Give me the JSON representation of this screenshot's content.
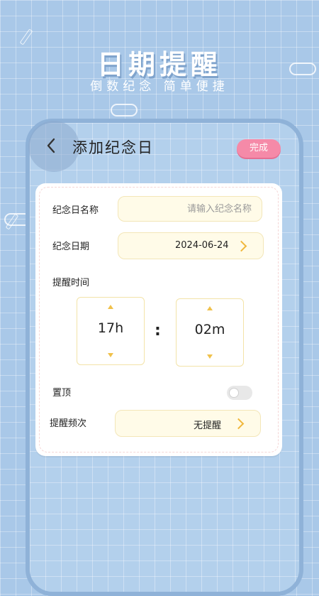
{
  "hero": {
    "title": "日期提醒",
    "subtitle": "倒数纪念   简单便捷"
  },
  "nav": {
    "back_icon": "chevron-left-icon",
    "title": "添加纪念日",
    "done_label": "完成"
  },
  "form": {
    "name_label": "纪念日名称",
    "name_value": "",
    "name_placeholder": "请输入纪念名称",
    "date_label": "纪念日期",
    "date_value": "2024-06-24",
    "reminder_time_label": "提醒时间",
    "hour_value": "17h",
    "minute_value": "02m",
    "colon": ":",
    "pin_label": "置顶",
    "pin_enabled": false,
    "frequency_label": "提醒频次",
    "frequency_value": "无提醒"
  },
  "colors": {
    "background": "#a9c8e8",
    "accent_pink": "#f58aa8",
    "accent_yellow": "#f0b73c",
    "field_bg": "#fffbe8"
  }
}
